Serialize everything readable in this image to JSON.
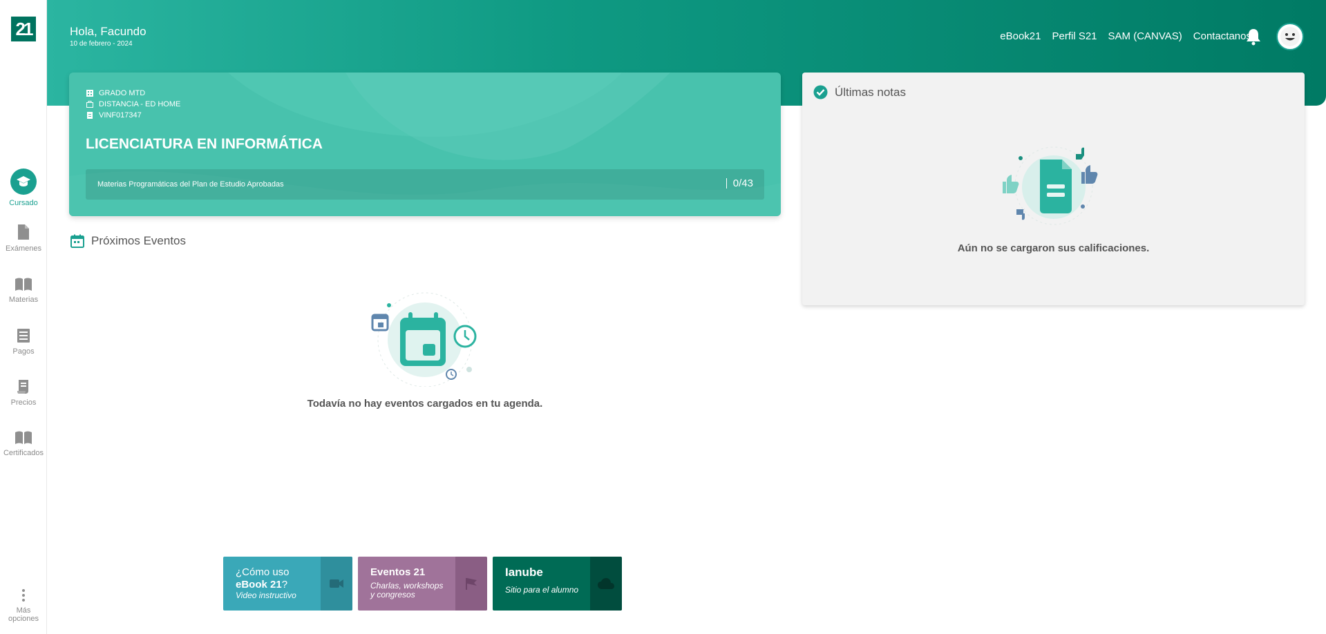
{
  "sidebar": {
    "logo": "21",
    "items": [
      {
        "label": "Cursado",
        "icon": "graduation-cap-icon"
      },
      {
        "label": "Exámenes",
        "icon": "file-icon"
      },
      {
        "label": "Materias",
        "icon": "book-open-icon"
      },
      {
        "label": "Pagos",
        "icon": "receipt-icon"
      },
      {
        "label": "Precios",
        "icon": "price-list-icon"
      },
      {
        "label": "Certificados",
        "icon": "certificate-book-icon"
      }
    ],
    "more_label_1": "Más",
    "more_label_2": "opciones"
  },
  "header": {
    "greeting": "Hola, Facundo",
    "date": "10 de febrero - 2024",
    "nav": [
      "eBook21",
      "Perfil S21",
      "SAM (CANVAS)",
      "Contactanos"
    ]
  },
  "program": {
    "level": "GRADO MTD",
    "modality": "DISTANCIA - ED HOME",
    "code": "VINF017347",
    "title": "LICENCIATURA EN INFORMÁTICA",
    "progress_label": "Materias Programáticas del Plan de Estudio Aprobadas",
    "progress_value": "0/43",
    "approved": 0,
    "total": 43
  },
  "events": {
    "title": "Próximos Eventos",
    "empty": "Todavía no hay eventos cargados en tu agenda."
  },
  "grades": {
    "title": "Últimas notas",
    "empty": "Aún no se cargaron sus calificaciones."
  },
  "tiles": [
    {
      "line1": "¿Cómo uso",
      "line2": "eBook 21",
      "line2_suffix": "?",
      "sub": "Video instructivo",
      "color": "#3aa8b8",
      "side_color": "#2f8f9d"
    },
    {
      "line1": "Eventos 21",
      "sub1": "Charlas, workshops",
      "sub2": "y congresos",
      "color": "#a0739a",
      "side_color": "#8a5e84"
    },
    {
      "line1": "Ianube",
      "sub": "Sitio para el alumno",
      "color": "#006b55",
      "side_color": "#014d3e"
    }
  ],
  "colors": {
    "accent": "#1aa090",
    "header_start": "#2bb5a1",
    "header_end": "#007a64",
    "card": "#48c2ad"
  }
}
